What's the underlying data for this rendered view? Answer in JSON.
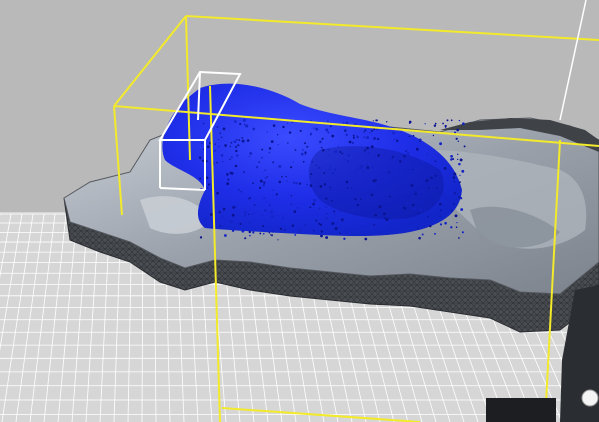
{
  "viewport": {
    "background_color": "#b9b9b9",
    "grid_color": "#ffffff",
    "ground_color": "#d6d6d6"
  },
  "scene": {
    "terrain_mesh": {
      "wire_color": "#3c3f44",
      "side_color": "#4a4d52",
      "surface_color": "#9aa1ab",
      "highlight_color": "#c3c9d1"
    },
    "particle_fluid": {
      "color": "#1f2ee8",
      "dark_color": "#0a1390",
      "dot_color": "#1424c4"
    },
    "domain_bounding_box": {
      "color": "#f2ea2a"
    },
    "emitter_box": {
      "color": "#ffffff"
    },
    "obstacle_object": {
      "color": "#2a2d31"
    }
  }
}
